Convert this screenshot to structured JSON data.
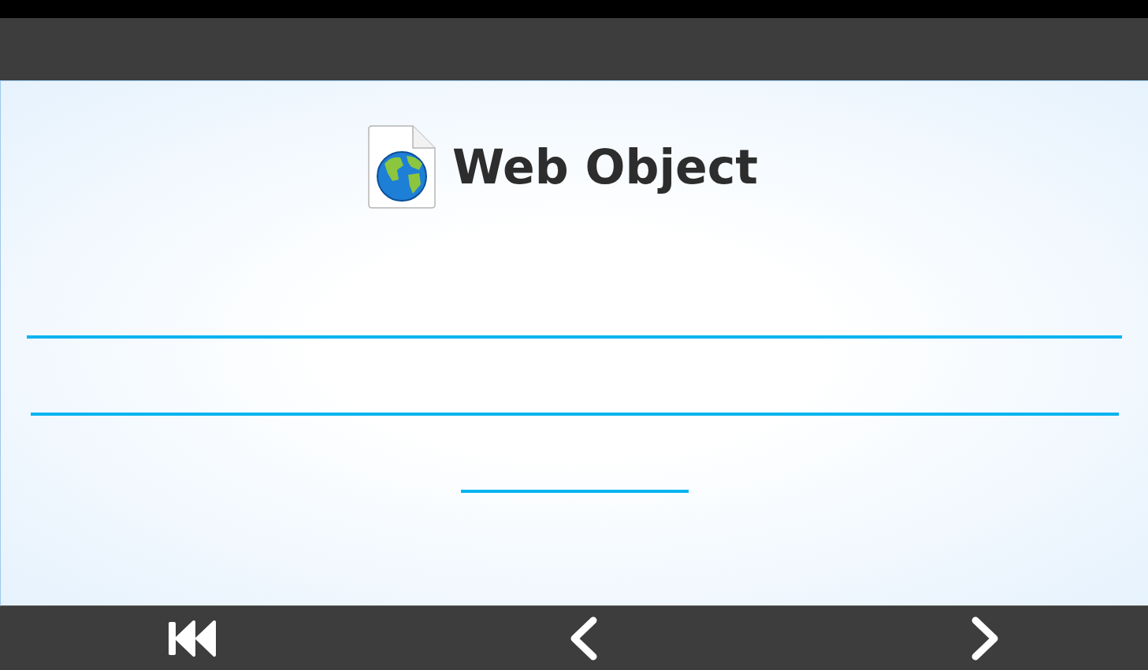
{
  "header": {
    "title": "Web Object"
  },
  "answer_lines": [
    {
      "kind": "full"
    },
    {
      "kind": "full"
    },
    {
      "kind": "short"
    }
  ],
  "navigation": [
    {
      "kind": "first"
    },
    {
      "kind": "previous"
    },
    {
      "kind": "next"
    }
  ]
}
